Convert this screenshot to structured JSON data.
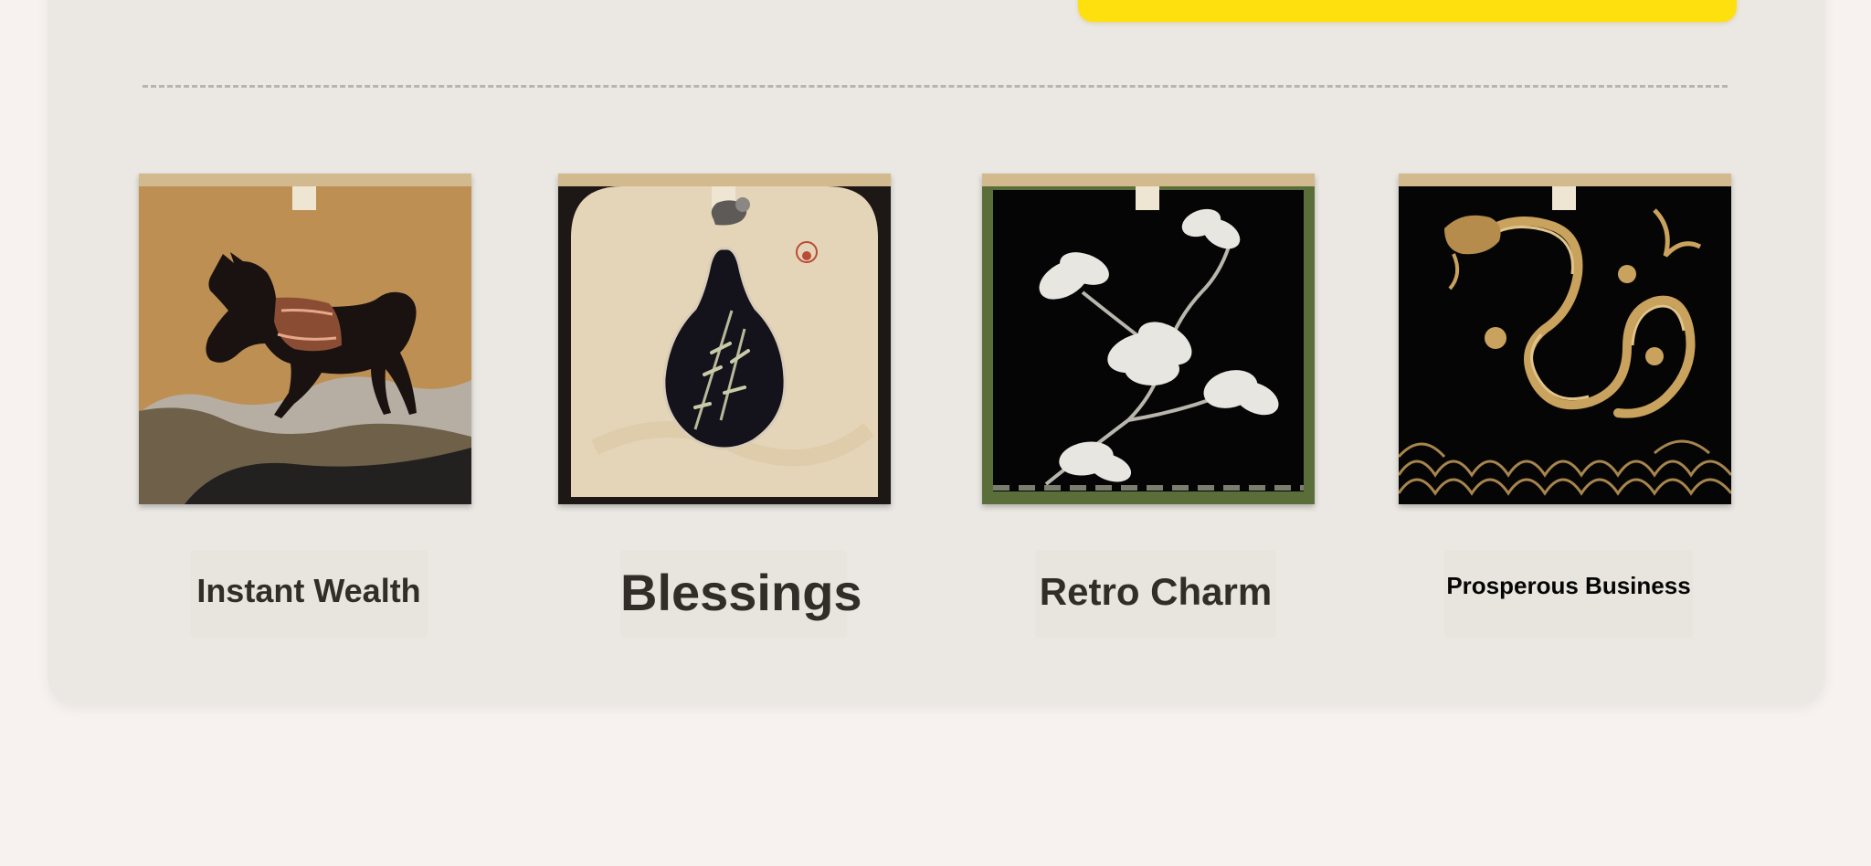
{
  "cta": {
    "label": "",
    "color": "#fee00f"
  },
  "cards": [
    {
      "label": "Instant Wealth",
      "art": "galloping-horse-icon",
      "accent": "#b98b47"
    },
    {
      "label": "Blessings",
      "art": "gourd-bamboo-icon",
      "accent": "#e6d6bb"
    },
    {
      "label": "Retro Charm",
      "art": "magnolia-icon",
      "accent": "#5a6e3a"
    },
    {
      "label": "Prosperous Business",
      "art": "golden-dragon-icon",
      "accent": "#c9a25d"
    }
  ]
}
